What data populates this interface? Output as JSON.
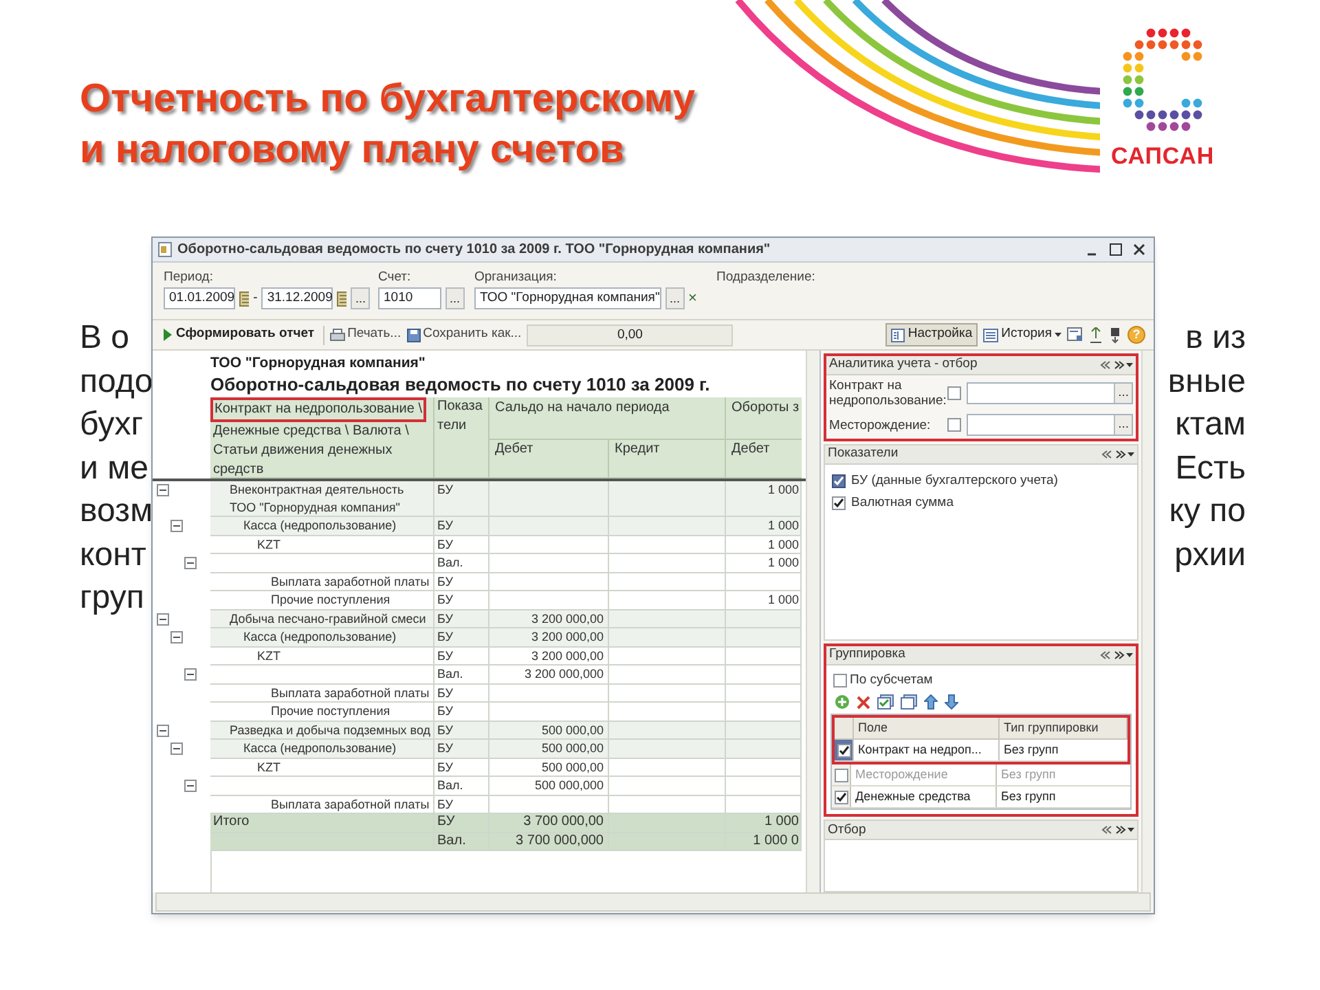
{
  "slide": {
    "title_lines": [
      "Отчетность по бухгалтерскому",
      "и налоговому плану счетов"
    ],
    "logo_text": "САПСАН",
    "body_lines": [
      {
        "left": "В о",
        "right": "в из"
      },
      {
        "left": "подо",
        "right": "вные"
      },
      {
        "left": "бухг",
        "right": "ктам"
      },
      {
        "left": "и ме",
        "right": "Есть"
      },
      {
        "left": "возм",
        "right": "ку по"
      },
      {
        "left": "конт",
        "right": "рхии"
      },
      {
        "left": "груп"
      }
    ]
  },
  "window": {
    "title": "Оборотно-сальдовая ведомость по счету 1010 за 2009 г. ТОО \"Горнорудная компания\""
  },
  "filters": {
    "period_label": "Период:",
    "date_from": "01.01.2009",
    "separator": "-",
    "date_to": "31.12.2009",
    "period_button": "...",
    "account_label": "Счет:",
    "account": "1010",
    "account_button": "...",
    "organization_label": "Организация:",
    "organization": "ТОО \"Горнорудная компания\"",
    "organization_button": "...",
    "organization_clear": "×",
    "subdivision_label": "Подразделение:"
  },
  "toolbar": {
    "generate": "Сформировать отчет",
    "print": "Печать...",
    "save": "Сохранить как...",
    "amount": "0,00",
    "settings": {
      "label": "Настройка",
      "pressed": true
    },
    "history": "История",
    "help": "?"
  },
  "report": {
    "company": "ТОО \"Горнорудная компания\"",
    "title": "Оборотно-сальдовая ведомость по счету 1010 за 2009 г.",
    "grouping_header": [
      {
        "text": "Контракт на недропользование \\",
        "highlighted": true
      },
      {
        "text": "Денежные средства \\ Валюта \\",
        "highlighted": false
      },
      {
        "text": "Статьи движения денежных средств",
        "highlighted": false
      }
    ],
    "indicator_header": [
      "Показа",
      "тели"
    ],
    "opening_header": "Сальдо на начало периода",
    "turnover_header": "Обороты з",
    "debit_header": "Дебет",
    "credit_header": "Кредит",
    "turnover_debit_header": "Дебет",
    "tree": [
      {
        "name": "Внеконтрактная деятельность ТОО \"Горнорудная компания\"",
        "lines": [
          {
            "indicator": "БУ",
            "turnover_debit": "1 000"
          }
        ],
        "expanded": true,
        "children": [
          {
            "name": "Касса (недропользование)",
            "lines": [
              {
                "indicator": "БУ",
                "turnover_debit": "1 000"
              }
            ],
            "expanded": true,
            "children": [
              {
                "name": "KZT",
                "lines": [
                  {
                    "indicator": "БУ",
                    "turnover_debit": "1 000"
                  },
                  {
                    "indicator": "Вал.",
                    "turnover_debit": "1 000"
                  }
                ],
                "expanded": true,
                "children": [
                  {
                    "name": "Выплата заработной платы",
                    "lines": [
                      {
                        "indicator": "БУ"
                      }
                    ]
                  },
                  {
                    "name": "Прочие поступления",
                    "lines": [
                      {
                        "indicator": "БУ",
                        "turnover_debit": "1 000"
                      }
                    ]
                  }
                ]
              }
            ]
          }
        ]
      },
      {
        "name": "Добыча песчано-гравийной смеси",
        "lines": [
          {
            "indicator": "БУ",
            "opening_debit": "3 200 000,00"
          }
        ],
        "expanded": true,
        "children": [
          {
            "name": "Касса (недропользование)",
            "lines": [
              {
                "indicator": "БУ",
                "opening_debit": "3 200 000,00"
              }
            ],
            "expanded": true,
            "children": [
              {
                "name": "KZT",
                "lines": [
                  {
                    "indicator": "БУ",
                    "opening_debit": "3 200 000,00"
                  },
                  {
                    "indicator": "Вал.",
                    "opening_debit": "3 200 000,000"
                  }
                ],
                "expanded": true,
                "children": [
                  {
                    "name": "Выплата заработной платы",
                    "lines": [
                      {
                        "indicator": "БУ"
                      }
                    ]
                  },
                  {
                    "name": "Прочие поступления",
                    "lines": [
                      {
                        "indicator": "БУ"
                      }
                    ]
                  }
                ]
              }
            ]
          }
        ]
      },
      {
        "name": "Разведка и добыча подземных вод",
        "lines": [
          {
            "indicator": "БУ",
            "opening_debit": "500 000,00"
          }
        ],
        "expanded": true,
        "children": [
          {
            "name": "Касса (недропользование)",
            "lines": [
              {
                "indicator": "БУ",
                "opening_debit": "500 000,00"
              }
            ],
            "expanded": true,
            "children": [
              {
                "name": "KZT",
                "lines": [
                  {
                    "indicator": "БУ",
                    "opening_debit": "500 000,00"
                  },
                  {
                    "indicator": "Вал.",
                    "opening_debit": "500 000,000"
                  }
                ],
                "expanded": true,
                "children": [
                  {
                    "name": "Выплата заработной платы",
                    "lines": [
                      {
                        "indicator": "БУ"
                      }
                    ]
                  }
                ]
              }
            ]
          }
        ]
      }
    ],
    "total": {
      "name": "Итого",
      "lines": [
        {
          "indicator": "БУ",
          "opening_debit": "3 700 000,00",
          "turnover_debit": "1 000"
        },
        {
          "indicator": "Вал.",
          "opening_debit": "3 700 000,000",
          "turnover_debit": "1 000 0"
        }
      ]
    }
  },
  "panel": {
    "analytics": {
      "title": "Аналитика учета - отбор",
      "highlighted": true,
      "fields": [
        {
          "label": "Контракт на недропользование:",
          "checked": false,
          "button": "..."
        },
        {
          "label": "Месторождение:",
          "checked": false,
          "button": "..."
        }
      ]
    },
    "indicators": {
      "title": "Показатели",
      "items": [
        {
          "label": "БУ (данные бухгалтерского учета)",
          "checked": true,
          "selected": true
        },
        {
          "label": "Валютная сумма",
          "checked": true,
          "selected": false
        }
      ]
    },
    "grouping": {
      "title": "Группировка",
      "highlighted": true,
      "by_subaccounts": {
        "label": "По субсчетам",
        "checked": false
      },
      "columns": [
        "Поле",
        "Тип группировки"
      ],
      "rows": [
        {
          "field": "Контракт на недроп...",
          "type": "Без групп",
          "checked": true,
          "selected": true,
          "highlighted": true
        },
        {
          "field": "Месторождение",
          "type": "Без групп",
          "checked": false,
          "selected": false,
          "highlighted": false
        },
        {
          "field": "Денежные средства",
          "type": "Без групп",
          "checked": true,
          "selected": false,
          "highlighted": false
        }
      ]
    },
    "filter": {
      "title": "Отбор"
    }
  }
}
